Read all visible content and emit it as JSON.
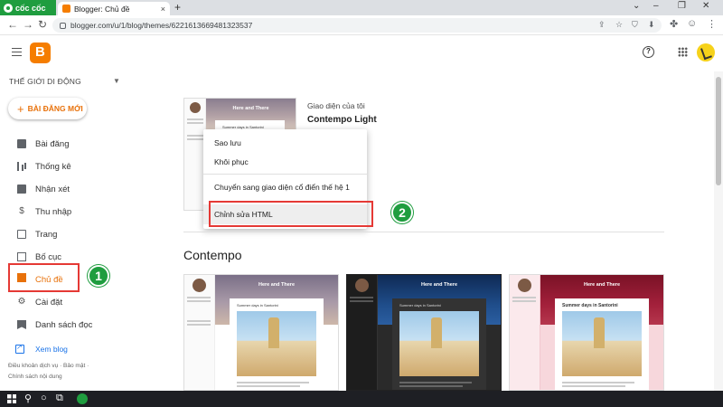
{
  "browser": {
    "brand_label": "cốc cốc",
    "tab_title": "Blogger: Chủ đề",
    "tab_close": "×",
    "new_tab": "+",
    "url": "blogger.com/u/1/blog/themes/6221613669481323537",
    "window_controls": [
      "⌄",
      "–",
      "❐",
      "✕"
    ],
    "nav_icons": [
      "←",
      "→",
      "↻"
    ]
  },
  "header": {
    "help_icon": "?",
    "accent_color": "#f57d00"
  },
  "sidebar": {
    "blog_name": "THẾ GIỚI DI ĐỘNG",
    "new_post_plus": "+",
    "new_post_label": "BÀI ĐĂNG MỚI",
    "items": [
      {
        "label": "Bài đăng",
        "icon": "posts-icon",
        "active": false
      },
      {
        "label": "Thống kê",
        "icon": "stats-icon",
        "active": false
      },
      {
        "label": "Nhận xét",
        "icon": "comments-icon",
        "active": false
      },
      {
        "label": "Thu nhập",
        "icon": "earnings-icon",
        "glyph": "$",
        "active": false
      },
      {
        "label": "Trang",
        "icon": "pages-icon",
        "active": false
      },
      {
        "label": "Bố cục",
        "icon": "layout-icon",
        "active": false
      },
      {
        "label": "Chủ đề",
        "icon": "theme-icon",
        "active": true
      },
      {
        "label": "Cài đặt",
        "icon": "settings-icon",
        "glyph": "⚙",
        "active": false
      },
      {
        "label": "Danh sách đọc",
        "icon": "reading-list-icon",
        "active": false
      }
    ],
    "view_blog": "Xem blog",
    "footer_line1": "Điều khoản dịch vụ · Bảo mật ·",
    "footer_line2": "Chính sách nội dung"
  },
  "main": {
    "my_theme_label": "Giao diện của tôi",
    "my_theme_name": "Contempo Light",
    "thumb_title": "Here and There",
    "thumb_post_title": "Summer days in Santorini",
    "section_title": "Contempo",
    "dropdown": [
      "Sao lưu",
      "Khôi phục",
      "Chuyển sang giao diện cổ điển thế hệ 1",
      "Chỉnh sửa HTML"
    ]
  },
  "annotations": {
    "step1": "1",
    "step2": "2",
    "highlight_color": "#e53935",
    "badge_color": "#1f9d3f"
  }
}
